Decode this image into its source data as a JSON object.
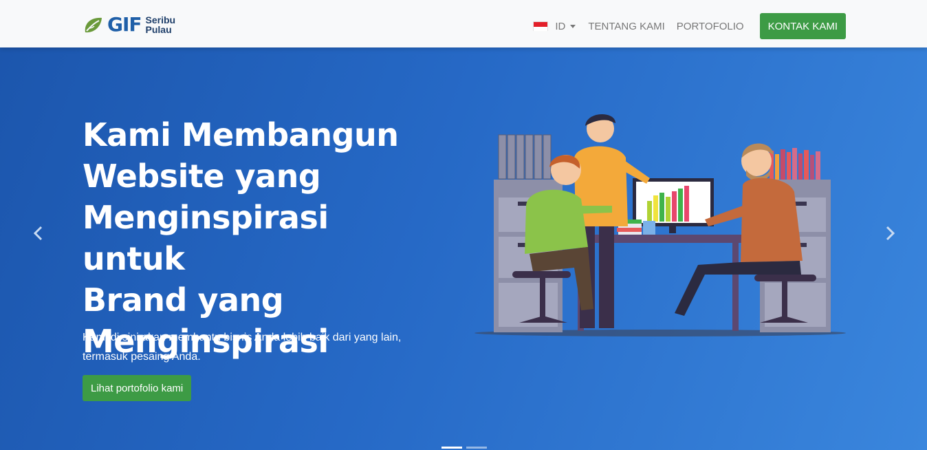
{
  "brand": {
    "name": "GIF",
    "sub_line1": "Seribu",
    "sub_line2": "Pulau"
  },
  "nav": {
    "language": "ID",
    "links": [
      "TENTANG KAMI",
      "PORTOFOLIO"
    ],
    "contact_label": "KONTAK KAMI"
  },
  "hero": {
    "headline_lines": [
      "Kami Membangun",
      "Website yang",
      "Menginspirasi untuk",
      "Brand yang",
      "Menginspirasi"
    ],
    "subtext_lines": [
      "Kami di sini akan membantu bisnis Anda lebih baik dari yang lain,",
      "termasuk pesaing Anda."
    ],
    "button_label": "Lihat portofolio kami"
  },
  "carousel": {
    "slides": 2,
    "active_index": 0
  },
  "colors": {
    "accent_green": "#3d9b45",
    "brand_blue": "#1f5fa8",
    "hero_start": "#1c56ad",
    "hero_end": "#3a86dd"
  },
  "icons": {
    "prev": "chevron-left-icon",
    "next": "chevron-right-icon",
    "flag": "indonesia-flag-icon"
  }
}
